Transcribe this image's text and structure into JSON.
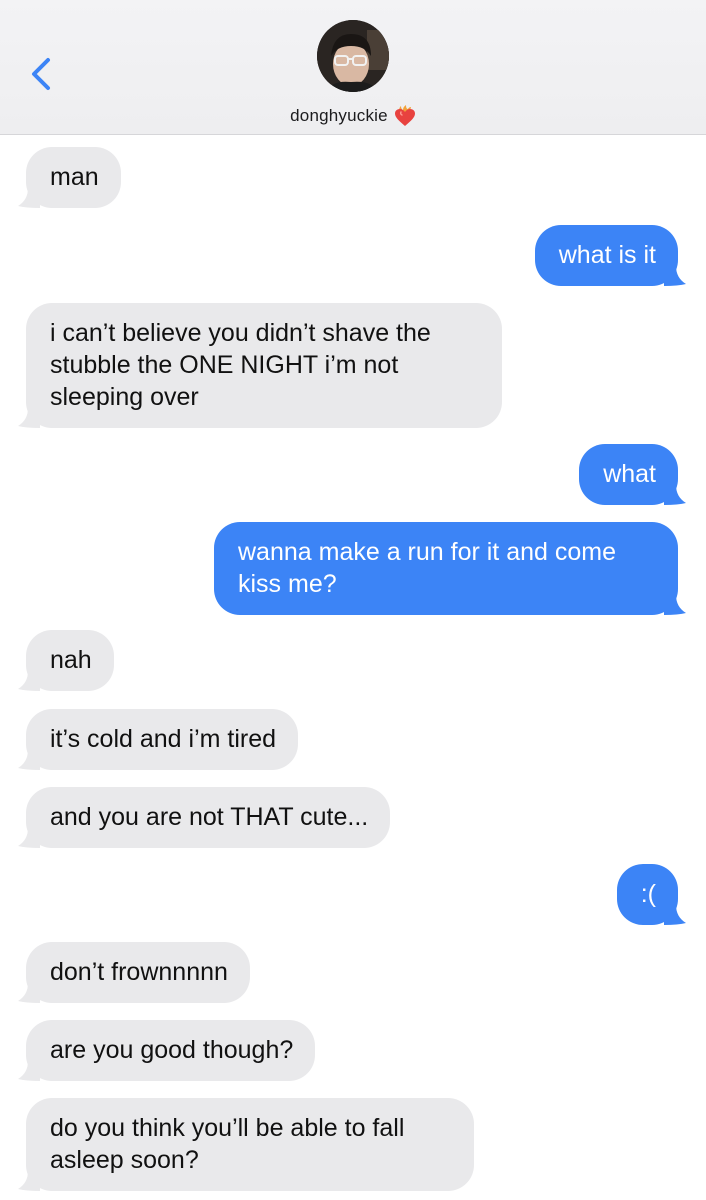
{
  "contact": {
    "name": "donghyuckie",
    "emoji": "heart-on-fire"
  },
  "colors": {
    "incoming_bubble": "#e9e9eb",
    "outgoing_bubble": "#3c84f6",
    "accent": "#3c84f6"
  },
  "messages": [
    {
      "dir": "in",
      "text": "man"
    },
    {
      "dir": "out",
      "text": "what is it"
    },
    {
      "dir": "in",
      "text": "i can’t believe you didn’t shave the stubble the ONE NIGHT i’m not sleeping over"
    },
    {
      "dir": "out",
      "text": "what"
    },
    {
      "dir": "out",
      "text": "wanna make a run for it and come kiss me?"
    },
    {
      "dir": "in",
      "text": "nah"
    },
    {
      "dir": "in",
      "text": "it’s cold and i’m tired"
    },
    {
      "dir": "in",
      "text": "and you are not THAT cute..."
    },
    {
      "dir": "out",
      "text": ":("
    },
    {
      "dir": "in",
      "text": "don’t frownnnnn"
    },
    {
      "dir": "in",
      "text": "are you good though?"
    },
    {
      "dir": "in",
      "text": "do you think you’ll be able to fall asleep soon?"
    }
  ]
}
